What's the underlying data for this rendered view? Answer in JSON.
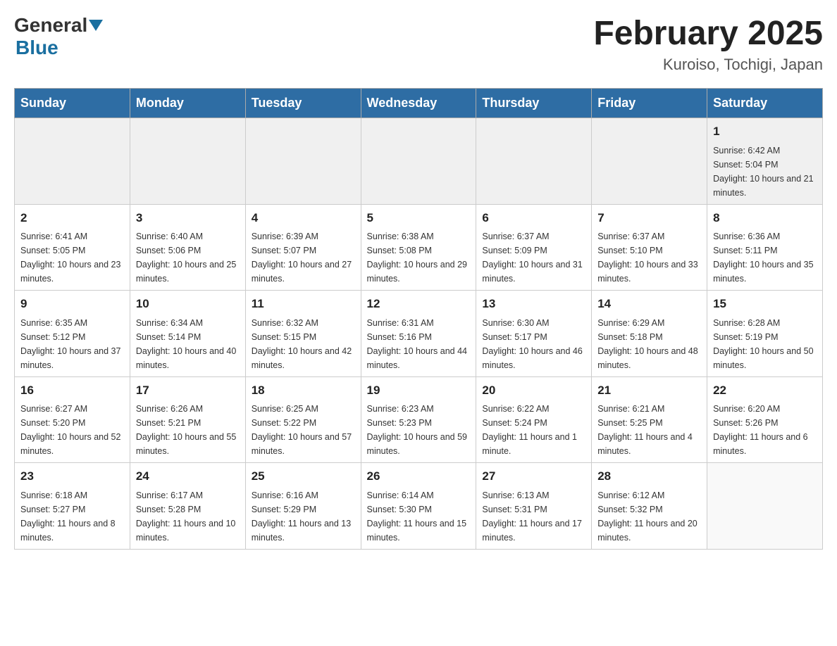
{
  "header": {
    "logo_general": "General",
    "logo_blue": "Blue",
    "title": "February 2025",
    "subtitle": "Kuroiso, Tochigi, Japan"
  },
  "days_of_week": [
    "Sunday",
    "Monday",
    "Tuesday",
    "Wednesday",
    "Thursday",
    "Friday",
    "Saturday"
  ],
  "weeks": [
    {
      "days": [
        {
          "num": "",
          "info": ""
        },
        {
          "num": "",
          "info": ""
        },
        {
          "num": "",
          "info": ""
        },
        {
          "num": "",
          "info": ""
        },
        {
          "num": "",
          "info": ""
        },
        {
          "num": "",
          "info": ""
        },
        {
          "num": "1",
          "info": "Sunrise: 6:42 AM\nSunset: 5:04 PM\nDaylight: 10 hours and 21 minutes."
        }
      ]
    },
    {
      "days": [
        {
          "num": "2",
          "info": "Sunrise: 6:41 AM\nSunset: 5:05 PM\nDaylight: 10 hours and 23 minutes."
        },
        {
          "num": "3",
          "info": "Sunrise: 6:40 AM\nSunset: 5:06 PM\nDaylight: 10 hours and 25 minutes."
        },
        {
          "num": "4",
          "info": "Sunrise: 6:39 AM\nSunset: 5:07 PM\nDaylight: 10 hours and 27 minutes."
        },
        {
          "num": "5",
          "info": "Sunrise: 6:38 AM\nSunset: 5:08 PM\nDaylight: 10 hours and 29 minutes."
        },
        {
          "num": "6",
          "info": "Sunrise: 6:37 AM\nSunset: 5:09 PM\nDaylight: 10 hours and 31 minutes."
        },
        {
          "num": "7",
          "info": "Sunrise: 6:37 AM\nSunset: 5:10 PM\nDaylight: 10 hours and 33 minutes."
        },
        {
          "num": "8",
          "info": "Sunrise: 6:36 AM\nSunset: 5:11 PM\nDaylight: 10 hours and 35 minutes."
        }
      ]
    },
    {
      "days": [
        {
          "num": "9",
          "info": "Sunrise: 6:35 AM\nSunset: 5:12 PM\nDaylight: 10 hours and 37 minutes."
        },
        {
          "num": "10",
          "info": "Sunrise: 6:34 AM\nSunset: 5:14 PM\nDaylight: 10 hours and 40 minutes."
        },
        {
          "num": "11",
          "info": "Sunrise: 6:32 AM\nSunset: 5:15 PM\nDaylight: 10 hours and 42 minutes."
        },
        {
          "num": "12",
          "info": "Sunrise: 6:31 AM\nSunset: 5:16 PM\nDaylight: 10 hours and 44 minutes."
        },
        {
          "num": "13",
          "info": "Sunrise: 6:30 AM\nSunset: 5:17 PM\nDaylight: 10 hours and 46 minutes."
        },
        {
          "num": "14",
          "info": "Sunrise: 6:29 AM\nSunset: 5:18 PM\nDaylight: 10 hours and 48 minutes."
        },
        {
          "num": "15",
          "info": "Sunrise: 6:28 AM\nSunset: 5:19 PM\nDaylight: 10 hours and 50 minutes."
        }
      ]
    },
    {
      "days": [
        {
          "num": "16",
          "info": "Sunrise: 6:27 AM\nSunset: 5:20 PM\nDaylight: 10 hours and 52 minutes."
        },
        {
          "num": "17",
          "info": "Sunrise: 6:26 AM\nSunset: 5:21 PM\nDaylight: 10 hours and 55 minutes."
        },
        {
          "num": "18",
          "info": "Sunrise: 6:25 AM\nSunset: 5:22 PM\nDaylight: 10 hours and 57 minutes."
        },
        {
          "num": "19",
          "info": "Sunrise: 6:23 AM\nSunset: 5:23 PM\nDaylight: 10 hours and 59 minutes."
        },
        {
          "num": "20",
          "info": "Sunrise: 6:22 AM\nSunset: 5:24 PM\nDaylight: 11 hours and 1 minute."
        },
        {
          "num": "21",
          "info": "Sunrise: 6:21 AM\nSunset: 5:25 PM\nDaylight: 11 hours and 4 minutes."
        },
        {
          "num": "22",
          "info": "Sunrise: 6:20 AM\nSunset: 5:26 PM\nDaylight: 11 hours and 6 minutes."
        }
      ]
    },
    {
      "days": [
        {
          "num": "23",
          "info": "Sunrise: 6:18 AM\nSunset: 5:27 PM\nDaylight: 11 hours and 8 minutes."
        },
        {
          "num": "24",
          "info": "Sunrise: 6:17 AM\nSunset: 5:28 PM\nDaylight: 11 hours and 10 minutes."
        },
        {
          "num": "25",
          "info": "Sunrise: 6:16 AM\nSunset: 5:29 PM\nDaylight: 11 hours and 13 minutes."
        },
        {
          "num": "26",
          "info": "Sunrise: 6:14 AM\nSunset: 5:30 PM\nDaylight: 11 hours and 15 minutes."
        },
        {
          "num": "27",
          "info": "Sunrise: 6:13 AM\nSunset: 5:31 PM\nDaylight: 11 hours and 17 minutes."
        },
        {
          "num": "28",
          "info": "Sunrise: 6:12 AM\nSunset: 5:32 PM\nDaylight: 11 hours and 20 minutes."
        },
        {
          "num": "",
          "info": ""
        }
      ]
    }
  ]
}
